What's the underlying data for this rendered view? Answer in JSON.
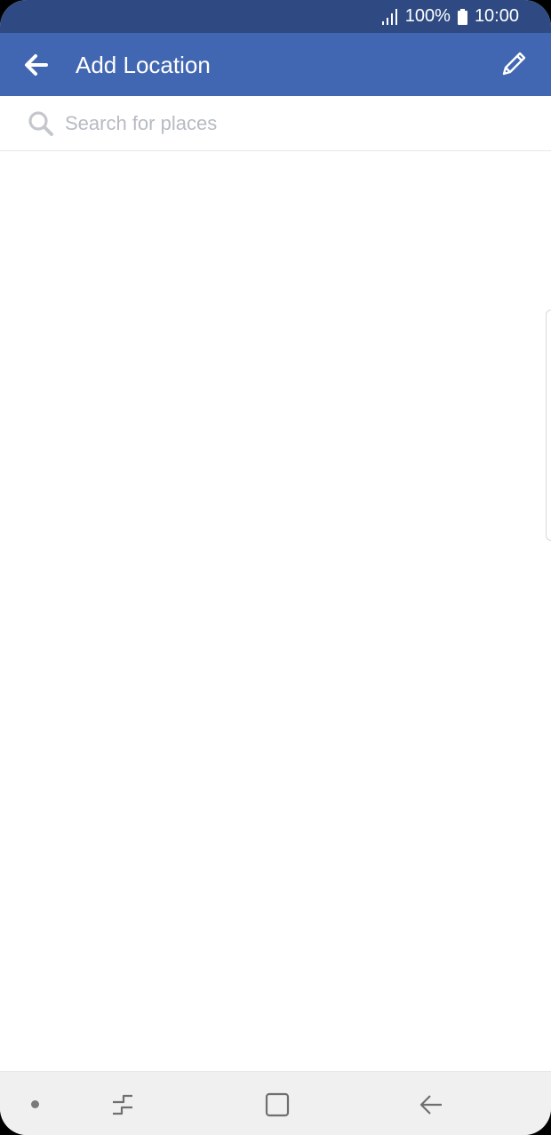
{
  "status_bar": {
    "battery_percent": "100%",
    "time": "10:00"
  },
  "app_bar": {
    "title": "Add Location",
    "back_icon": "arrow-left-icon",
    "edit_icon": "pencil-icon"
  },
  "search": {
    "placeholder": "Search for places",
    "value": "",
    "icon": "search-icon"
  },
  "nav_bar": {
    "icons": [
      "dot-icon",
      "recents-icon",
      "home-icon",
      "back-icon"
    ]
  },
  "colors": {
    "status_bar": "#2f4a82",
    "app_bar": "#4267b2",
    "placeholder": "#b7bbc2",
    "nav_bar": "#f0f0f0"
  }
}
